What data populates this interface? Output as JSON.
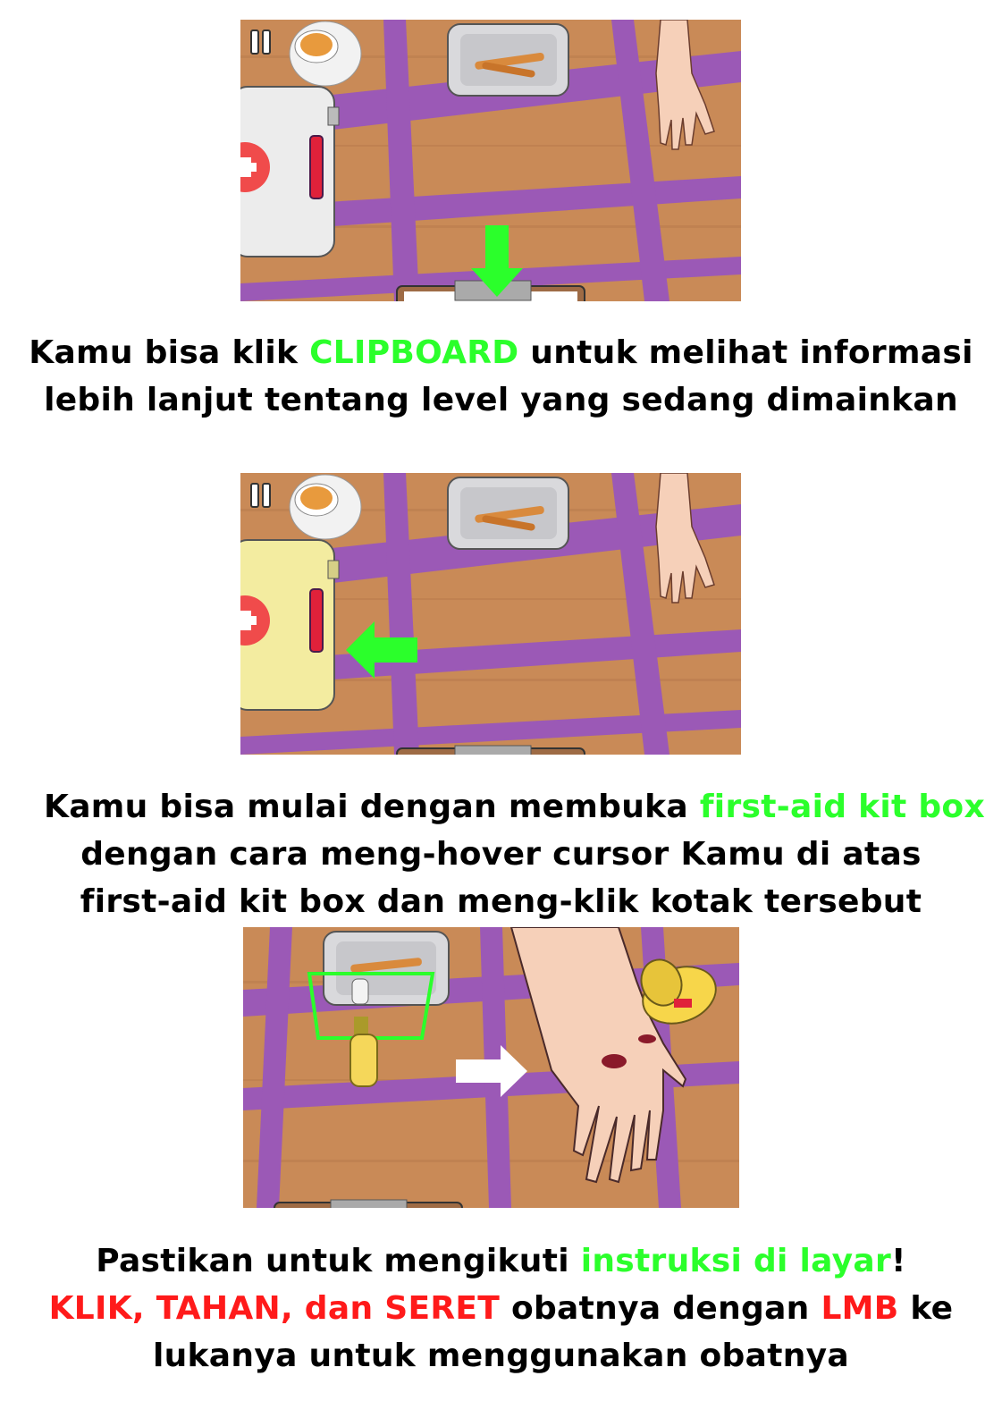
{
  "colors": {
    "highlight_green": "#2bff2b",
    "highlight_red": "#ff1a1a",
    "table_wood": "#c98a57",
    "table_stripe": "#9b59b6",
    "arrow_green": "#2bff2b",
    "arrow_white": "#ffffff"
  },
  "icons": [
    "pause-icon",
    "tea-cup-icon",
    "tray-icon",
    "hand-icon",
    "first-aid-kit-icon",
    "arrow-down-icon",
    "arrow-left-icon",
    "arrow-right-icon",
    "ointment-bottle-icon",
    "cup-icon"
  ],
  "step1": {
    "caption": {
      "line1_a": "Kamu bisa klik ",
      "line1_b": "CLIPBOARD",
      "line1_c": " untuk melihat informasi",
      "line2": "lebih lanjut tentang level yang sedang dimainkan"
    }
  },
  "step2": {
    "caption": {
      "line1_a": "Kamu bisa mulai dengan membuka ",
      "line1_b": "first-aid kit box",
      "line2": "dengan cara meng-hover cursor Kamu di atas",
      "line3": "first-aid kit box dan meng-klik kotak tersebut"
    }
  },
  "step3": {
    "caption": {
      "line1_a": "Pastikan untuk mengikuti ",
      "line1_b": "instruksi di layar",
      "line1_c": "!",
      "line2_a": "KLIK, TAHAN, dan SERET",
      "line2_b": " obatnya dengan ",
      "line2_c": "LMB",
      "line2_d": " ke",
      "line3": "lukanya untuk menggunakan obatnya"
    }
  }
}
